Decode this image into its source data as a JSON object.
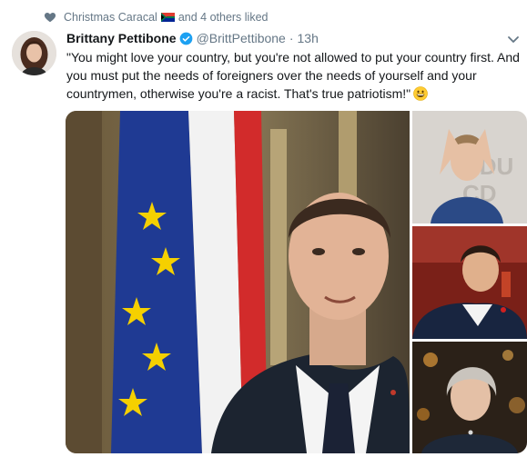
{
  "social_context": {
    "liker": "Christmas Caracal",
    "liker_flag": "south-africa-flag-icon",
    "suffix": "and 4 others liked"
  },
  "tweet": {
    "display_name": "Brittany Pettibone",
    "verified": true,
    "handle": "@BrittPettibone",
    "separator": "·",
    "time": "13h",
    "text": "\"You might love your country, but you're not allowed to put your country first. And you must put the needs of foreigners over the needs of yourself and your countrymen, otherwise you're a racist. That's true patriotism!\"",
    "emoji": "grinning-face-emoji"
  },
  "media": {
    "count": 4,
    "photos": [
      "main-photo",
      "side-photo-1",
      "side-photo-2",
      "side-photo-3"
    ]
  },
  "colors": {
    "text": "#14171a",
    "muted": "#657786",
    "verified": "#1da1f2"
  }
}
